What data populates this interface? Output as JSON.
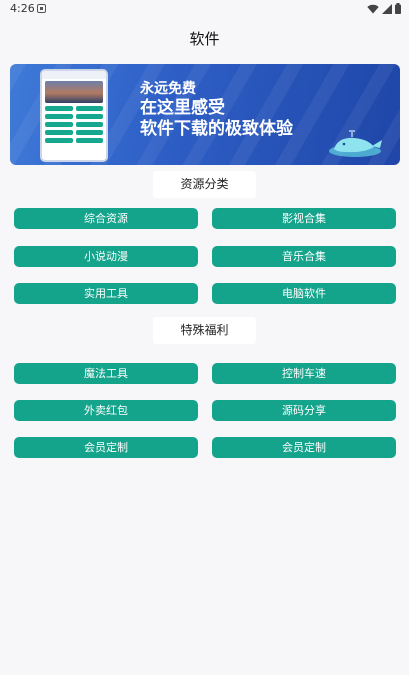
{
  "status_bar": {
    "time": "4:26"
  },
  "header": {
    "title": "软件"
  },
  "banner": {
    "line1": "永远免费",
    "line2": "在这里感受",
    "line3": "软件下载的极致体验"
  },
  "sections": [
    {
      "title": "资源分类",
      "buttons": [
        "综合资源",
        "影视合集",
        "小说动漫",
        "音乐合集",
        "实用工具",
        "电脑软件"
      ]
    },
    {
      "title": "特殊福利",
      "buttons": [
        "魔法工具",
        "控制车速",
        "外卖红包",
        "源码分享",
        "会员定制",
        "会员定制"
      ]
    }
  ],
  "colors": {
    "button_bg": "#14a38b",
    "banner_bg": "#2e5fc6",
    "page_bg": "#f7f7f9"
  }
}
